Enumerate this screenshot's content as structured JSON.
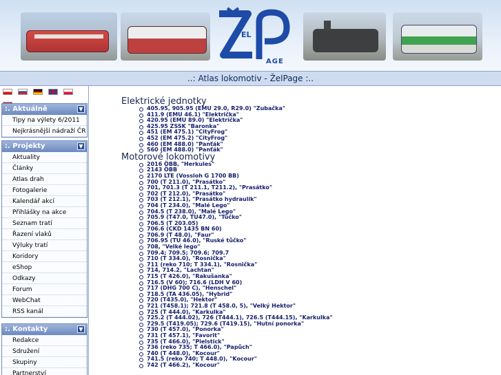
{
  "logo": {
    "text_main": "ŽEL",
    "text_page": "PAGE"
  },
  "title": "..: Atlas lokomotiv - ŽelPage :..",
  "flags": [
    {
      "name": "czech-flag-icon"
    },
    {
      "name": "slovak-flag-icon"
    },
    {
      "name": "german-flag-icon"
    },
    {
      "name": "uk-flag-icon"
    },
    {
      "name": "polish-flag-icon"
    },
    {
      "name": "hungarian-flag-icon"
    }
  ],
  "sidebar": {
    "aktualne": {
      "heading": ":. Aktuálně",
      "items": [
        "Tipy na výlety 6/2011",
        "Nejkrásnější nádraží ČR"
      ]
    },
    "projekty": {
      "heading": ":. Projekty",
      "items": [
        "Aktuality",
        "Články",
        "Atlas drah",
        "Fotogalerie",
        "Kalendář akcí",
        "Přihlášky na akce",
        "Seznam tratí",
        "Řazení vlaků",
        "Výluky tratí",
        "Koridory",
        "eShop",
        "Odkazy",
        "Forum",
        "WebChat",
        "RSS kanál"
      ]
    },
    "kontakty": {
      "heading": ":. Kontakty",
      "items": [
        "Redakce",
        "Sdružení",
        "Skupiny",
        "Partnerství"
      ]
    }
  },
  "main": {
    "sections": [
      {
        "title": "Elektrické jednotky",
        "entries": [
          "405.95, 905.95 (EMU 29.0, R29.0) \"Zubačka\"",
          "411.9 (EMU 46.1) \"Električka\"",
          "420.95 (EMU 89.0) \"Električka\"",
          "425.95 ZSSK \"Baronka\"",
          "451 (EM 475.1) \"CityFrog\"",
          "452 (EM 475.2) \"CityFrog\"",
          "460 (EM 488.0) \"Panťák\"",
          "560 (EM 488.0) \"Panťák\""
        ]
      },
      {
        "title": "Motorové lokomotivy",
        "entries": [
          "2016 ÖBB, \"Herkules\"",
          "2143 ÖBB",
          "2170 LTE (Vossloh G 1700 BB)",
          "700 (T 211.0), \"Prasátko\"",
          "701, 701.3 (T 211.1, T211.2), \"Prasátko\"",
          "702 (T 212.0), \"Prasátko\"",
          "703 (T 212.1), \"Prasátko hydraulik\"",
          "704 (T 234.0), \"Malé Lego\"",
          "704.5 (T 238.0), \"Malé Lego\"",
          "705.9 (T47.0, TU47.0), \"Tůčko\"",
          "706.5 (T 203.05)",
          "706.6 (CKD 1435 BN 60)",
          "706.9 (T 48.0), \"Faur\"",
          "706.95 (TU 46.0), \"Ruské tůčko\"",
          "708, \"Velké lego\"",
          "709.4; 709.5; 709.6; 709.7",
          "710 (T 334.0), \"Rosnička\"",
          "711 (reko 710; T 334.1), \"Rosnička\"",
          "714, 714.2, \"Lachtan\"",
          "715 (T 426.0), \"Rakušanka\"",
          "716.5 (V 60); 716.6 (LDH V 60)",
          "717 (DHG 700 C), \"Henschel\"",
          "718.5 (TA 436.05), \"Hybrid\"",
          "720 (T435.0), \"Hektor\"",
          "721 (T458.1); 721.8 (T 458.0, 5), \"Velký Hektor\"",
          "725 (T 444.0), \"Karkulka\"",
          "725.2 (T 444.02), 726 (T444.1), 726.5 (T444.15), \"Karkulka\"",
          "729.5 (T419.05); 729.6 (T419.15), \"Hutní ponorka\"",
          "730 (T 457.0), \"Ponorka\"",
          "731 (T 457.1), \"Favorit\"",
          "735 (T 466.0), \"Pielstick\"",
          "736 (reko 735; T 466.0), \"Papůch\"",
          "740 (T 448.0), \"Kocour\"",
          "741.5 (reko 740; T 448.0), \"Kocour\"",
          "742 (T 466.2), \"Kocour\""
        ]
      }
    ]
  }
}
